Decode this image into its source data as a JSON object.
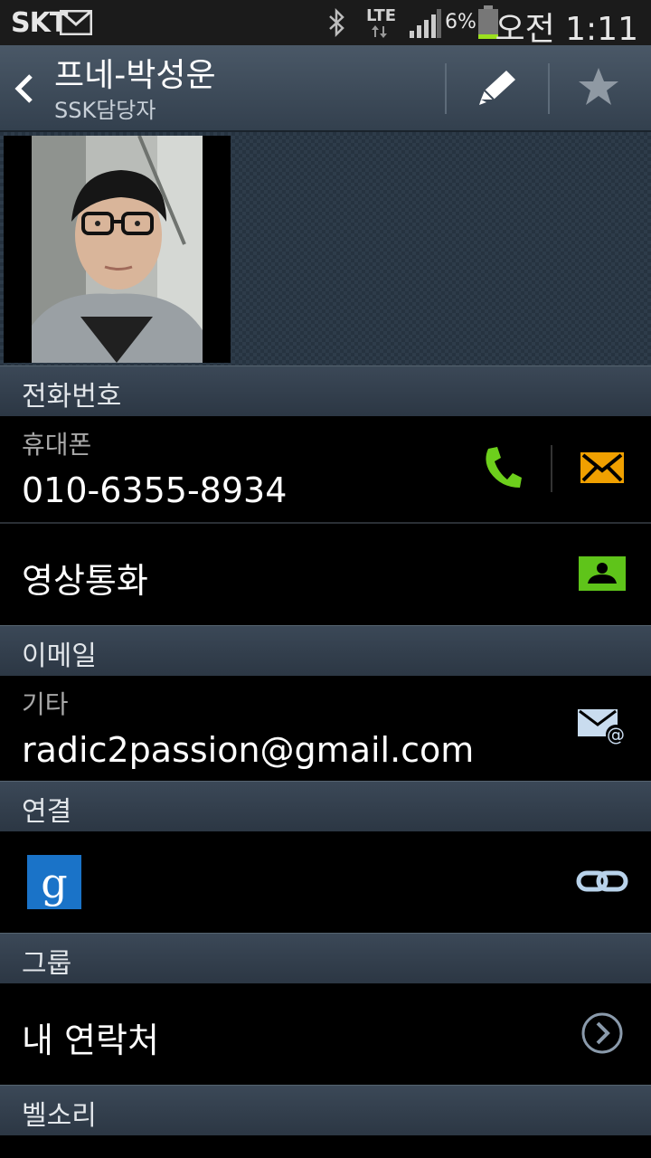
{
  "status": {
    "carrier": "SKT",
    "network": "LTE",
    "battery": "6%",
    "time": "오전 1:11"
  },
  "header": {
    "name": "프네-박성운",
    "subtitle": "SSK담당자"
  },
  "sections": {
    "phone": "전화번호",
    "email": "이메일",
    "connection": "연결",
    "group": "그룹",
    "ringtone": "벨소리"
  },
  "phone": {
    "label": "휴대폰",
    "number": "010-6355-8934"
  },
  "video_call": {
    "label": "영상통화"
  },
  "email": {
    "label": "기타",
    "address": "radic2passion@gmail.com"
  },
  "group": {
    "value": "내 연락처"
  },
  "colors": {
    "call_green": "#6dcf1c",
    "message_orange": "#f0a000",
    "video_green": "#5fc41a",
    "google_blue": "#1a73c8"
  },
  "icons": [
    "mail-icon",
    "bluetooth-icon",
    "signal-icon",
    "battery-icon",
    "back-icon",
    "edit-icon",
    "star-icon",
    "call-icon",
    "message-icon",
    "video-call-icon",
    "email-icon",
    "google-icon",
    "link-icon",
    "chevron-right-icon"
  ]
}
